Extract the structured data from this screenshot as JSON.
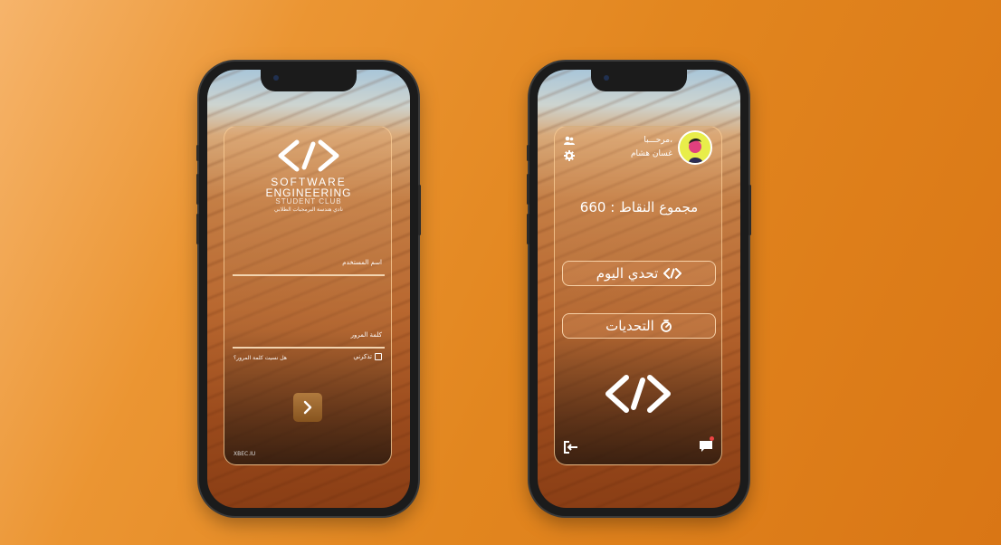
{
  "login_screen": {
    "brand": {
      "line1": "SOFTWARE",
      "line2": "ENGINEERING",
      "line3": "STUDENT CLUB",
      "arabic": "نادي هندسة البرمجيات الطلابي"
    },
    "username_label": "اسم المستخدم",
    "password_label": "كلمة المرور",
    "remember_label": "تذكرني",
    "forgot_label": "هل نسيت كلمة المرور؟",
    "footer_brand": "XBEC.IU"
  },
  "home_screen": {
    "greeting": "مرحـــبا،",
    "user_name": "غسان هشام",
    "points_text": "مجموع النقاط : 660",
    "today_challenge_label": "تحدي اليوم",
    "challenges_label": "التحديات"
  },
  "colors": {
    "background_accent": "#e2861f",
    "card_border": "#facd96"
  }
}
